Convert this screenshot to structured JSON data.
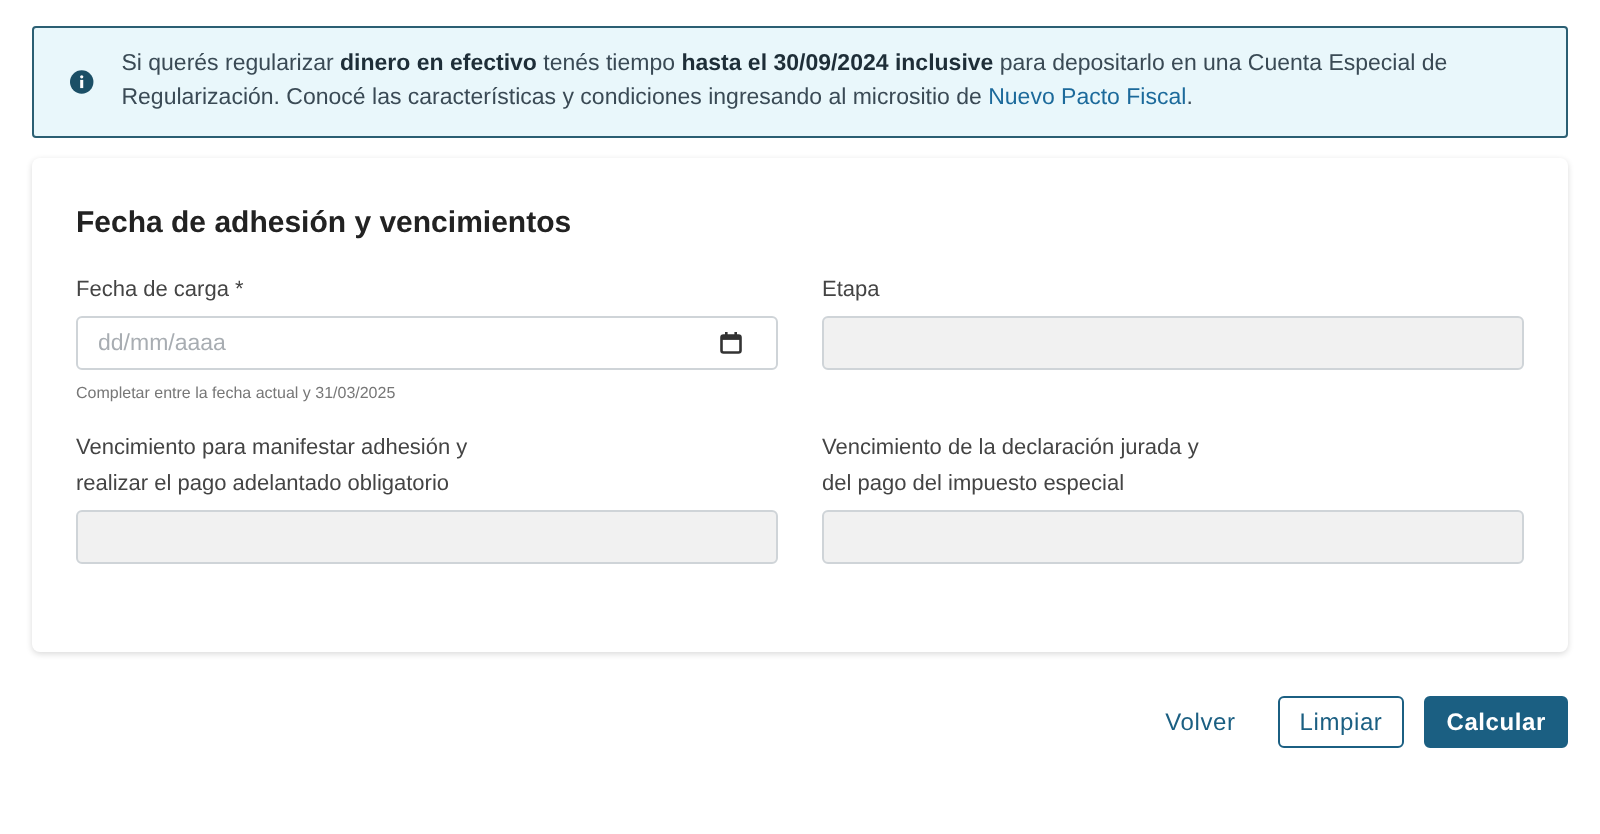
{
  "alert": {
    "text": "Si querés regularizar **dinero en efectivo** tenés tiempo **hasta el 30/09/2024 inclusive** para depositarlo en una Cuenta Especial de Regularización. Conocé las características y condiciones ingresando al micrositio de ",
    "link": "Nuevo Pacto Fiscal",
    "text_after": "."
  },
  "card": {
    "title": "Fecha de adhesión y vencimientos",
    "fields": [
      {
        "kind": "date",
        "label_lines": [
          "Fecha de carga *"
        ],
        "placeholder": "dd/mm/aaaa",
        "hint": "Completar entre la fecha actual y 31/03/2025",
        "disabled": false
      },
      {
        "kind": "text",
        "label_lines": [
          "Etapa"
        ],
        "disabled": true
      },
      {
        "kind": "text",
        "label_lines": [
          "Vencimiento para manifestar adhesión y",
          "realizar el pago adelantado obligatorio"
        ],
        "disabled": true
      },
      {
        "kind": "text",
        "label_lines": [
          "Vencimiento de la declaración jurada y",
          "del pago del impuesto especial"
        ],
        "disabled": true
      }
    ]
  },
  "buttons": [
    {
      "kind": "text",
      "label": "Volver"
    },
    {
      "kind": "outline",
      "label": "Limpiar"
    },
    {
      "kind": "primary",
      "label": "Calcular"
    }
  ]
}
